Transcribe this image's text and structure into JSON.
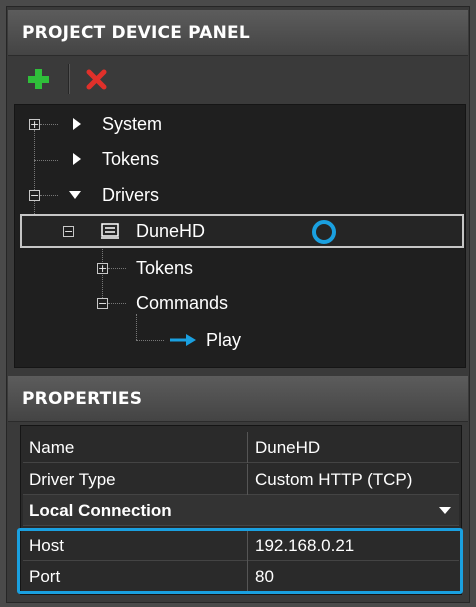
{
  "device_panel": {
    "title": "PROJECT DEVICE PANEL",
    "toolbar": {
      "add_icon": "plus-icon",
      "delete_icon": "x-icon"
    },
    "tree": {
      "system": "System",
      "tokens_root": "Tokens",
      "drivers": "Drivers",
      "device": "DuneHD",
      "tokens_child": "Tokens",
      "commands": "Commands",
      "play": "Play"
    }
  },
  "properties": {
    "title": "PROPERTIES",
    "rows": [
      {
        "name": "Name",
        "value": "DuneHD"
      },
      {
        "name": "Driver Type",
        "value": "Custom HTTP (TCP)"
      }
    ],
    "group": "Local Connection",
    "connection_rows": [
      {
        "name": "Host",
        "value": "192.168.0.21"
      },
      {
        "name": "Port",
        "value": "80"
      }
    ]
  },
  "colors": {
    "highlight": "#1aa0e0",
    "add": "#2fbf3a",
    "delete": "#e0302a"
  }
}
